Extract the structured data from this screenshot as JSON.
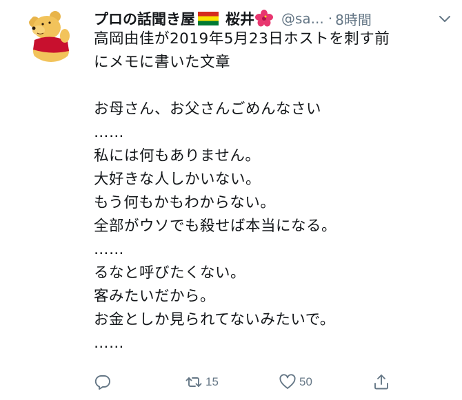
{
  "tweet": {
    "display_name": "プロの話聞き屋",
    "name_part2": "桜井",
    "handle": "@sa...",
    "separator": "·",
    "time": "8時間",
    "lines": [
      "高岡由佳が2019年5月23日ホストを刺す前",
      "にメモに書いた文章",
      "",
      "お母さん、お父さんごめんなさい",
      "……",
      "私には何もありません。",
      "大好きな人しかいない。",
      "もう何もかもわからない。",
      "全部がウソでも殺せば本当になる。",
      "……",
      "るなと呼びたくない。",
      "客みたいだから。",
      "お金としか見られてないみたいで。",
      "……"
    ],
    "retweet_count": "15",
    "like_count": "50"
  },
  "icons": {
    "avatar": "winnie-the-pooh-avatar",
    "flag": "bolivia-flag-emoji",
    "flower": "hibiscus-emoji",
    "menu": "chevron-down-icon",
    "reply": "reply-icon",
    "retweet": "retweet-icon",
    "like": "heart-icon",
    "share": "share-icon"
  },
  "colors": {
    "text_primary": "#14171a",
    "text_secondary": "#657786",
    "icon_gray": "#657786",
    "flag_red": "#d52b1e",
    "flag_yellow": "#f9e300",
    "flag_green": "#007934",
    "hibiscus_pink": "#e8366f"
  }
}
